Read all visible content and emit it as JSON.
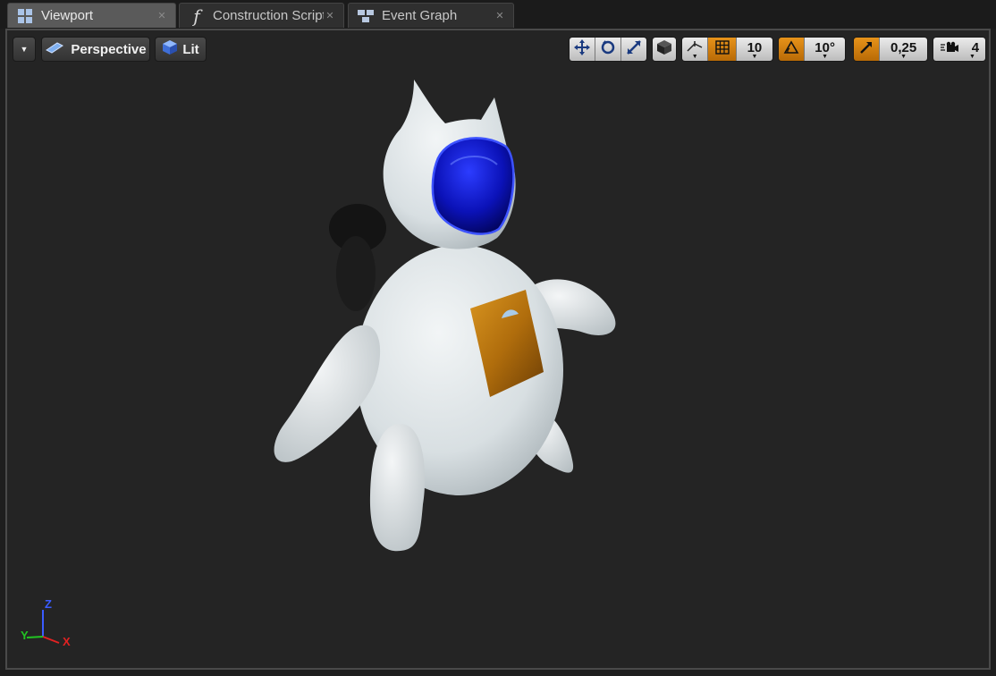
{
  "tabs": [
    {
      "label": "Viewport",
      "icon": "viewport-grid-icon",
      "active": true
    },
    {
      "label": "Construction Script",
      "icon": "function-icon",
      "active": false
    },
    {
      "label": "Event Graph",
      "icon": "event-graph-icon",
      "active": false
    }
  ],
  "toolbar": {
    "view_mode_label": "Perspective",
    "lighting_label": "Lit",
    "grid_snap_value": "10",
    "rotation_snap_value": "10°",
    "scale_snap_value": "0,25",
    "camera_speed_value": "4"
  },
  "axis_labels": {
    "x": "X",
    "y": "Y",
    "z": "Z"
  },
  "colors": {
    "accent_orange": "#e08a12",
    "viewport_bg": "#242424",
    "visor_blue": "#0a0fb0",
    "badge_orange": "#c07a10"
  }
}
